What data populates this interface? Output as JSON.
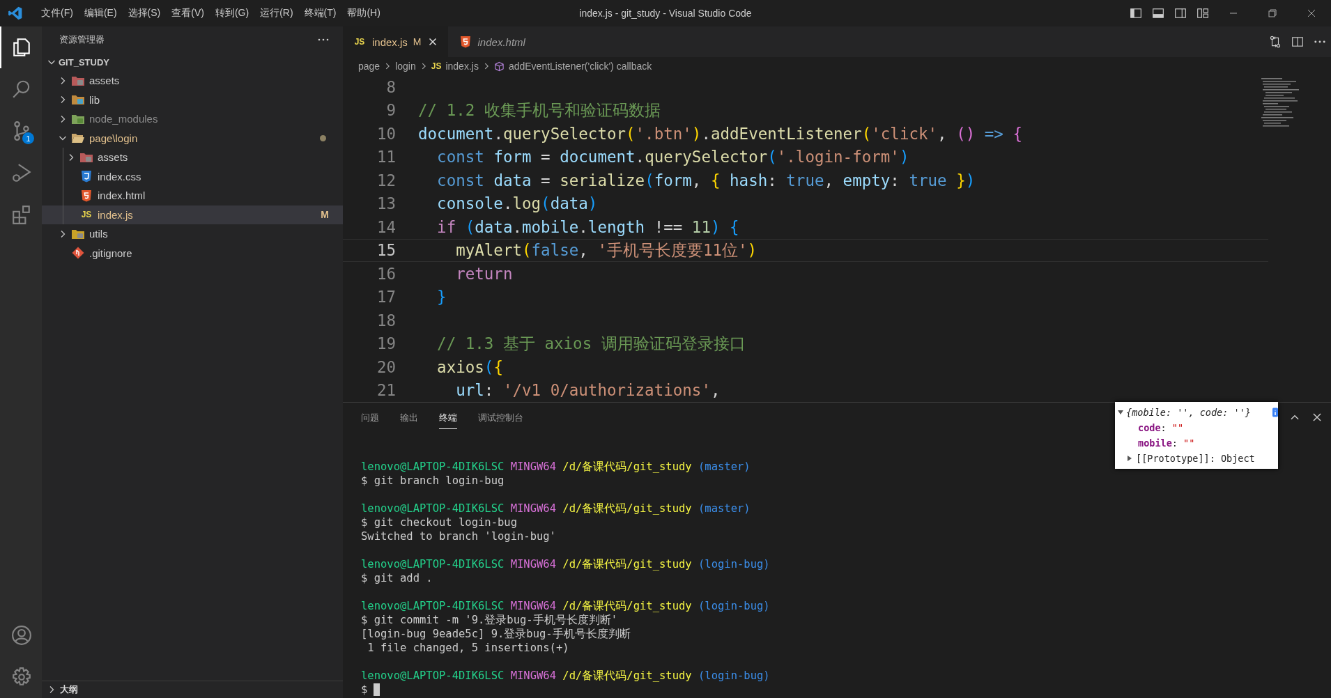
{
  "title_bar": {
    "menu": [
      "文件(F)",
      "编辑(E)",
      "选择(S)",
      "查看(V)",
      "转到(G)",
      "运行(R)",
      "终端(T)",
      "帮助(H)"
    ],
    "title": "index.js - git_study - Visual Studio Code"
  },
  "activity_bar": {
    "items": [
      {
        "kind": "explorer",
        "selected": true
      },
      {
        "kind": "search",
        "selected": false
      },
      {
        "kind": "scm",
        "selected": false,
        "badge": "1"
      },
      {
        "kind": "debug",
        "selected": false
      },
      {
        "kind": "extensions",
        "selected": false
      }
    ],
    "bottom": [
      {
        "kind": "account"
      },
      {
        "kind": "settings"
      }
    ]
  },
  "sidebar": {
    "title": "资源管理器",
    "root": {
      "label": "GIT_STUDY",
      "expanded": true
    },
    "tree": [
      {
        "label": "assets",
        "kind": "assets",
        "expanded": false,
        "selected": false
      },
      {
        "label": "lib",
        "kind": "lib",
        "expanded": false,
        "selected": false
      },
      {
        "label": "node_modules",
        "kind": "node",
        "expanded": false,
        "selected": false,
        "ignored": true
      },
      {
        "label": "page\\login",
        "kind": "folder",
        "expanded": true,
        "selected": false,
        "modified": true,
        "children": [
          {
            "label": "assets",
            "kind": "assets",
            "expanded": false,
            "selected": false
          },
          {
            "label": "index.css",
            "kind": "css",
            "selected": false
          },
          {
            "label": "index.html",
            "kind": "html",
            "selected": false
          },
          {
            "label": "index.js",
            "kind": "js",
            "icon_text": "JS",
            "selected": true,
            "modified": true,
            "badge": "M"
          }
        ]
      },
      {
        "label": "utils",
        "kind": "tools",
        "expanded": false,
        "selected": false
      },
      {
        "label": ".gitignore",
        "kind": "git",
        "selected": false
      }
    ],
    "outline": {
      "label": "大纲",
      "expanded": false
    }
  },
  "tabs": [
    {
      "label": "index.js",
      "kind": "js",
      "icon_text": "JS",
      "badge": "M",
      "selected": true,
      "preview": false
    },
    {
      "label": "index.html",
      "kind": "html",
      "selected": false,
      "preview": true
    }
  ],
  "breadcrumb": [
    {
      "kind": "folder",
      "label": "page"
    },
    {
      "kind": "folder",
      "label": "login"
    },
    {
      "kind": "file",
      "icon_text": "JS",
      "label": "index.js"
    },
    {
      "kind": "symbol",
      "label": "addEventListener('click') callback"
    }
  ],
  "editor": {
    "lines": [
      {
        "number": "8",
        "current": false
      },
      {
        "number": "9",
        "current": false,
        "tokens": [
          {
            "kind": "comment",
            "text": "// 1.2 收集手机号和验证码数据"
          }
        ]
      },
      {
        "number": "10",
        "current": false,
        "tokens": [
          {
            "kind": "variable",
            "text": "document"
          },
          {
            "kind": "plain",
            "text": "."
          },
          {
            "kind": "function",
            "text": "querySelector"
          },
          {
            "kind": "bracket1",
            "text": "("
          },
          {
            "kind": "string",
            "text": "'.btn'"
          },
          {
            "kind": "bracket1",
            "text": ")"
          },
          {
            "kind": "plain",
            "text": "."
          },
          {
            "kind": "function",
            "text": "addEventListener"
          },
          {
            "kind": "bracket1",
            "text": "("
          },
          {
            "kind": "string",
            "text": "'click'"
          },
          {
            "kind": "plain",
            "text": ", "
          },
          {
            "kind": "bracket2",
            "text": "()"
          },
          {
            "kind": "keyword",
            "text": " => "
          },
          {
            "kind": "bracket2",
            "text": "{"
          }
        ]
      },
      {
        "number": "11",
        "current": false,
        "tokens": [
          {
            "kind": "keyword",
            "text": "  const "
          },
          {
            "kind": "variable",
            "text": "form"
          },
          {
            "kind": "plain",
            "text": " = "
          },
          {
            "kind": "variable",
            "text": "document"
          },
          {
            "kind": "plain",
            "text": "."
          },
          {
            "kind": "function",
            "text": "querySelector"
          },
          {
            "kind": "bracket3",
            "text": "("
          },
          {
            "kind": "string",
            "text": "'.login-form'"
          },
          {
            "kind": "bracket3",
            "text": ")"
          }
        ]
      },
      {
        "number": "12",
        "current": false,
        "tokens": [
          {
            "kind": "keyword",
            "text": "  const "
          },
          {
            "kind": "variable",
            "text": "data"
          },
          {
            "kind": "plain",
            "text": " = "
          },
          {
            "kind": "function",
            "text": "serialize"
          },
          {
            "kind": "bracket3",
            "text": "("
          },
          {
            "kind": "variable",
            "text": "form"
          },
          {
            "kind": "plain",
            "text": ", "
          },
          {
            "kind": "bracket1",
            "text": "{ "
          },
          {
            "kind": "variable",
            "text": "hash"
          },
          {
            "kind": "plain",
            "text": ": "
          },
          {
            "kind": "keyword",
            "text": "true"
          },
          {
            "kind": "plain",
            "text": ", "
          },
          {
            "kind": "variable",
            "text": "empty"
          },
          {
            "kind": "plain",
            "text": ": "
          },
          {
            "kind": "keyword",
            "text": "true "
          },
          {
            "kind": "bracket1",
            "text": "}"
          },
          {
            "kind": "bracket3",
            "text": ")"
          }
        ]
      },
      {
        "number": "13",
        "current": false,
        "tokens": [
          {
            "kind": "variable",
            "text": "  console"
          },
          {
            "kind": "plain",
            "text": "."
          },
          {
            "kind": "function",
            "text": "log"
          },
          {
            "kind": "bracket3",
            "text": "("
          },
          {
            "kind": "variable",
            "text": "data"
          },
          {
            "kind": "bracket3",
            "text": ")"
          }
        ]
      },
      {
        "number": "14",
        "current": false,
        "tokens": [
          {
            "kind": "control",
            "text": "  if "
          },
          {
            "kind": "bracket3",
            "text": "("
          },
          {
            "kind": "variable",
            "text": "data"
          },
          {
            "kind": "plain",
            "text": "."
          },
          {
            "kind": "variable",
            "text": "mobile"
          },
          {
            "kind": "plain",
            "text": "."
          },
          {
            "kind": "variable",
            "text": "length"
          },
          {
            "kind": "plain",
            "text": " !== "
          },
          {
            "kind": "number",
            "text": "11"
          },
          {
            "kind": "bracket3",
            "text": ") {"
          }
        ]
      },
      {
        "number": "15",
        "current": true,
        "tokens": [
          {
            "kind": "function",
            "text": "    myAlert"
          },
          {
            "kind": "bracket1",
            "text": "("
          },
          {
            "kind": "keyword",
            "text": "false"
          },
          {
            "kind": "plain",
            "text": ", "
          },
          {
            "kind": "string",
            "text": "'手机号长度要11位'"
          },
          {
            "kind": "bracket1",
            "text": ")"
          }
        ]
      },
      {
        "number": "16",
        "current": false,
        "tokens": [
          {
            "kind": "control",
            "text": "    return"
          }
        ]
      },
      {
        "number": "17",
        "current": false,
        "tokens": [
          {
            "kind": "bracket3",
            "text": "  }"
          }
        ]
      },
      {
        "number": "18",
        "current": false
      },
      {
        "number": "19",
        "current": false,
        "tokens": [
          {
            "kind": "comment",
            "text": "  // 1.3 基于 axios 调用验证码登录接口"
          }
        ]
      },
      {
        "number": "20",
        "current": false,
        "tokens": [
          {
            "kind": "function",
            "text": "  axios"
          },
          {
            "kind": "bracket3",
            "text": "("
          },
          {
            "kind": "bracket1",
            "text": "{"
          }
        ]
      },
      {
        "number": "21",
        "current": false,
        "tokens": [
          {
            "kind": "variable",
            "text": "    url"
          },
          {
            "kind": "plain",
            "text": ": "
          },
          {
            "kind": "string",
            "text": "'/v1 0/authorizations'"
          },
          {
            "kind": "plain",
            "text": ","
          }
        ]
      }
    ]
  },
  "panel": {
    "tabs": [
      {
        "label": "问题",
        "selected": false
      },
      {
        "label": "输出",
        "selected": false
      },
      {
        "label": "终端",
        "selected": true
      },
      {
        "label": "调试控制台",
        "selected": false
      }
    ],
    "terminal": [
      {
        "kind": "prompt",
        "user": "lenovo@LAPTOP-4DIK6LSC",
        "system": "MINGW64",
        "path": "/d/备课代码/git_study",
        "branch": "(master)"
      },
      {
        "kind": "output",
        "text": "$ git branch login-bug"
      },
      {
        "kind": "blank"
      },
      {
        "kind": "prompt",
        "user": "lenovo@LAPTOP-4DIK6LSC",
        "system": "MINGW64",
        "path": "/d/备课代码/git_study",
        "branch": "(master)"
      },
      {
        "kind": "output",
        "text": "$ git checkout login-bug"
      },
      {
        "kind": "output",
        "text": "Switched to branch 'login-bug'"
      },
      {
        "kind": "blank"
      },
      {
        "kind": "prompt",
        "user": "lenovo@LAPTOP-4DIK6LSC",
        "system": "MINGW64",
        "path": "/d/备课代码/git_study",
        "branch": "(login-bug)"
      },
      {
        "kind": "output",
        "text": "$ git add ."
      },
      {
        "kind": "blank"
      },
      {
        "kind": "prompt",
        "user": "lenovo@LAPTOP-4DIK6LSC",
        "system": "MINGW64",
        "path": "/d/备课代码/git_study",
        "branch": "(login-bug)"
      },
      {
        "kind": "output",
        "text": "$ git commit -m '9.登录bug-手机号长度判断'"
      },
      {
        "kind": "output",
        "text": "[login-bug 9eade5c] 9.登录bug-手机号长度判断"
      },
      {
        "kind": "output",
        "text": " 1 file changed, 5 insertions(+)"
      },
      {
        "kind": "blank"
      },
      {
        "kind": "prompt",
        "user": "lenovo@LAPTOP-4DIK6LSC",
        "system": "MINGW64",
        "path": "/d/备课代码/git_study",
        "branch": "(login-bug)"
      },
      {
        "kind": "input",
        "text": "$"
      }
    ],
    "popup": {
      "summary": "{mobile: '', code: ''}",
      "entries": [
        {
          "key": "code",
          "separator": ":",
          "value": "\"\""
        },
        {
          "key": "mobile",
          "separator": ":",
          "value": "\"\""
        }
      ],
      "prototype": "[[Prototype]]: Object"
    }
  }
}
